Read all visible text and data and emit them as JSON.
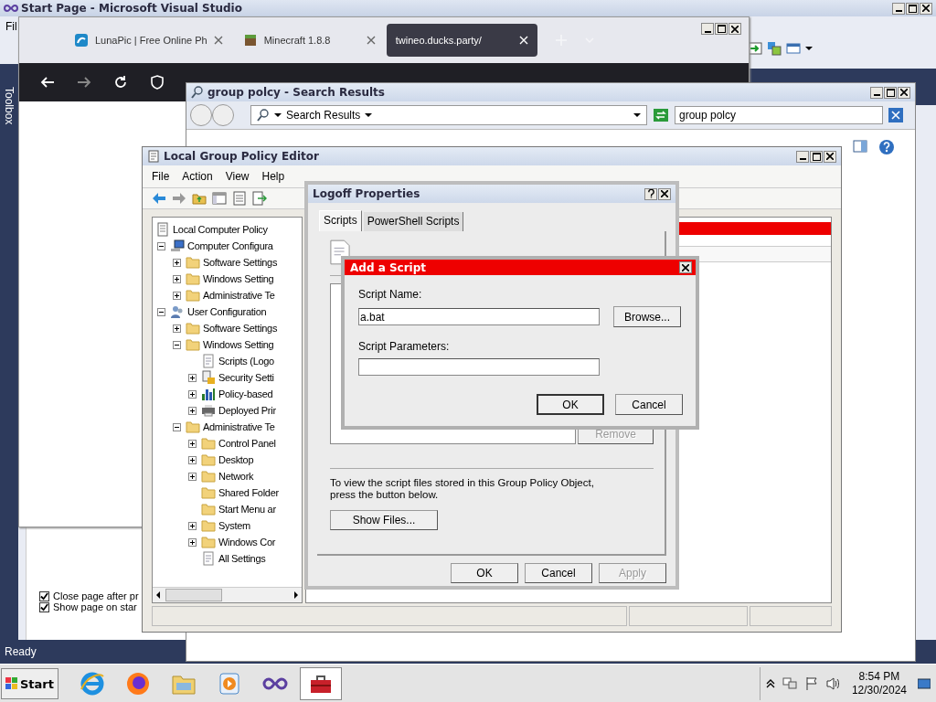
{
  "vs": {
    "title": "Start Page - Microsoft Visual Studio",
    "menu": "Fil",
    "toolbox": "Toolbox",
    "status": "Ready",
    "checkboxes": [
      {
        "label": "Close page after pr",
        "checked": true
      },
      {
        "label": "Show page on star",
        "checked": true
      }
    ]
  },
  "browser": {
    "tabs": [
      {
        "title": "LunaPic | Free Online Ph",
        "selected": false,
        "kind": "lunapic"
      },
      {
        "title": "Minecraft 1.8.8",
        "selected": false,
        "kind": "block"
      },
      {
        "title": "twineo.ducks.party/",
        "selected": true,
        "kind": "none"
      }
    ]
  },
  "search_window": {
    "title": "group polcy - Search Results",
    "location": "Search Results",
    "query": "group polcy"
  },
  "gpedit": {
    "title": "Local Group Policy Editor",
    "menu": [
      "File",
      "Action",
      "View",
      "Help"
    ],
    "tree": [
      {
        "label": "Local Computer Policy",
        "kind": "policy",
        "children": [
          {
            "label": "Computer Configura",
            "kind": "computer",
            "expanded": true,
            "children": [
              {
                "label": "Software Settings",
                "kind": "folder",
                "expanded": false
              },
              {
                "label": "Windows Setting",
                "kind": "folder",
                "expanded": false
              },
              {
                "label": "Administrative Te",
                "kind": "folder",
                "expanded": false
              }
            ]
          },
          {
            "label": "User Configuration",
            "kind": "user",
            "expanded": true,
            "children": [
              {
                "label": "Software Settings",
                "kind": "folder",
                "expanded": false
              },
              {
                "label": "Windows Setting",
                "kind": "folder",
                "expanded": true,
                "children": [
                  {
                    "label": "Scripts (Logo",
                    "kind": "script"
                  },
                  {
                    "label": "Security Setti",
                    "kind": "security",
                    "expanded": false
                  },
                  {
                    "label": "Policy-based",
                    "kind": "chart",
                    "expanded": false
                  },
                  {
                    "label": "Deployed Prir",
                    "kind": "printer",
                    "expanded": false
                  }
                ]
              },
              {
                "label": "Administrative Te",
                "kind": "folder",
                "expanded": true,
                "children": [
                  {
                    "label": "Control Panel",
                    "kind": "folder",
                    "expanded": false
                  },
                  {
                    "label": "Desktop",
                    "kind": "folder",
                    "expanded": false
                  },
                  {
                    "label": "Network",
                    "kind": "folder",
                    "expanded": false
                  },
                  {
                    "label": "Shared Folder",
                    "kind": "folder"
                  },
                  {
                    "label": "Start Menu ar",
                    "kind": "folder"
                  },
                  {
                    "label": "System",
                    "kind": "folder",
                    "expanded": false
                  },
                  {
                    "label": "Windows Cor",
                    "kind": "folder",
                    "expanded": false
                  },
                  {
                    "label": "All Settings",
                    "kind": "script"
                  }
                ]
              }
            ]
          }
        ]
      }
    ]
  },
  "logoff": {
    "title": "Logoff Properties",
    "tabs": [
      {
        "label": "Scripts",
        "selected": true
      },
      {
        "label": "PowerShell Scripts",
        "selected": false
      }
    ],
    "remove": {
      "label": "Remove",
      "disabled": true
    },
    "info": "To view the script files stored in this Group Policy Object, press the button below.",
    "show_files": "Show Files...",
    "buttons": [
      {
        "label": "OK",
        "disabled": false
      },
      {
        "label": "Cancel",
        "disabled": false
      },
      {
        "label": "Apply",
        "disabled": true
      }
    ]
  },
  "add_script": {
    "title": "Add a Script",
    "name_label": "Script Name:",
    "name_value": "a.bat",
    "params_label": "Script Parameters:",
    "browse": "Browse...",
    "buttons": [
      "OK",
      "Cancel"
    ]
  },
  "taskbar": {
    "start": "Start",
    "apps": [
      {
        "kind": "ie",
        "active": false
      },
      {
        "kind": "firefox",
        "active": false
      },
      {
        "kind": "explorer",
        "active": false
      },
      {
        "kind": "media",
        "active": false
      },
      {
        "kind": "vs",
        "active": false
      },
      {
        "kind": "toolbox",
        "active": true
      }
    ],
    "time": "8:54 PM",
    "date": "12/30/2024"
  }
}
